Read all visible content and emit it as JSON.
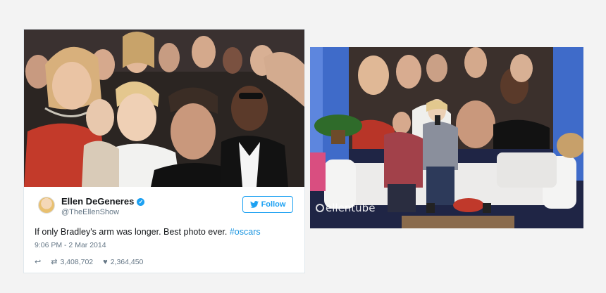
{
  "tweet": {
    "author_name": "Ellen DeGeneres",
    "handle": "@TheEllenShow",
    "follow_label": "Follow",
    "text_main": "If only Bradley's arm was longer. Best photo ever. ",
    "hashtag": "#oscars",
    "timestamp": "9:06 PM - 2 Mar 2014",
    "retweets": "3,408,702",
    "likes": "2,364,450",
    "icons": {
      "reply": "reply-icon",
      "retweet": "retweet-icon",
      "like": "heart-icon",
      "verified": "verified-badge-icon",
      "follow": "twitter-bird-icon"
    }
  },
  "video": {
    "watermark": "ellentube"
  },
  "colors": {
    "twitter_blue": "#1da1f2",
    "hashtag_blue": "#1b95e0",
    "muted_text": "#657786",
    "page_bg": "#f3f3f3"
  }
}
